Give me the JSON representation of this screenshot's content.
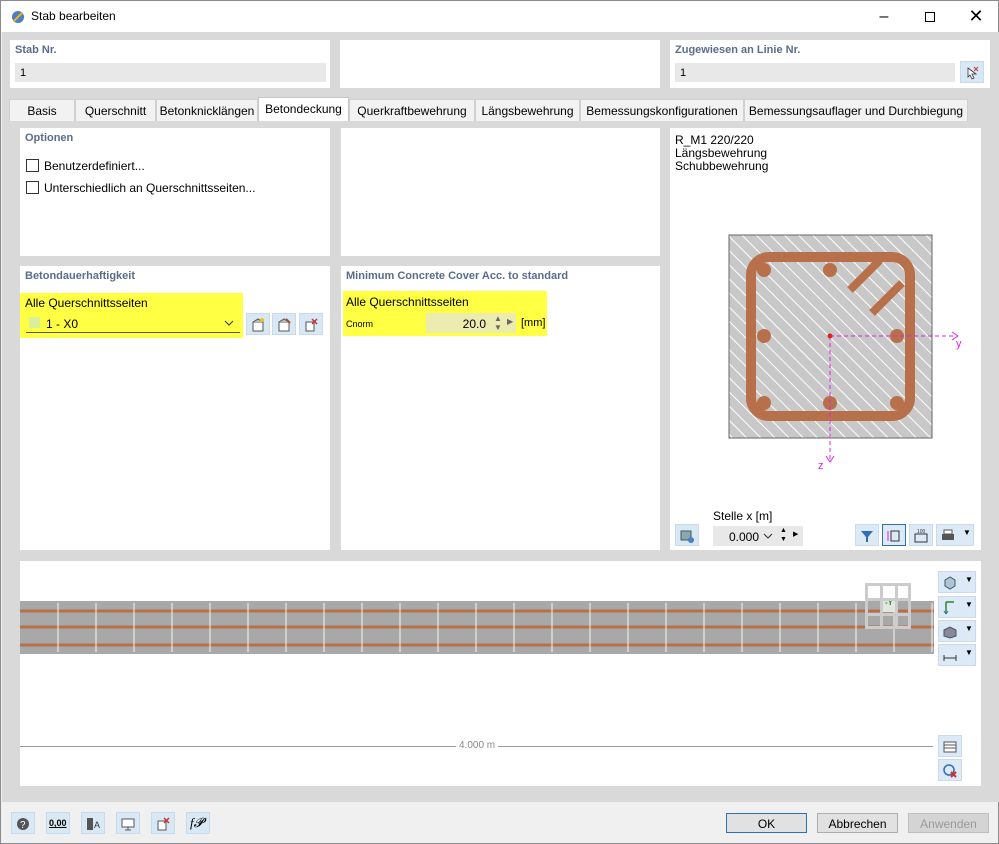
{
  "window": {
    "title": "Stab bearbeiten",
    "icons": [
      "minimize-icon",
      "maximize-icon",
      "close-icon"
    ]
  },
  "header": {
    "stab_label": "Stab Nr.",
    "stab_value": "1",
    "linie_label": "Zugewiesen an Linie Nr.",
    "linie_value": "1"
  },
  "tabs": [
    "Basis",
    "Querschnitt",
    "Betonknicklängen",
    "Betondeckung",
    "Querkraftbewehrung",
    "Längsbewehrung",
    "Bemessungskonfigurationen",
    "Bemessungsauflager und Durchbiegung"
  ],
  "active_tab": "Betondeckung",
  "optionen": {
    "title": "Optionen",
    "checkbox1": "Benutzerdefiniert...",
    "checkbox2": "Unterschiedlich an Querschnittsseiten..."
  },
  "dauer": {
    "title": "Betondauerhaftigkeit",
    "label": "Alle Querschnittsseiten",
    "value": "1 - X0"
  },
  "mincover": {
    "title": "Minimum Concrete Cover Acc. to standard",
    "label": "Alle Querschnittsseiten",
    "cnorm_label": "Cnorm",
    "cnorm_value": "20.0",
    "unit": "[mm]"
  },
  "preview": {
    "line1": "R_M1 220/220",
    "line2": "Längsbewehrung",
    "line3": "Schubbewehrung",
    "axis_y": "y",
    "axis_z": "z",
    "stelle_label": "Stelle x [m]",
    "stelle_value": "0.000"
  },
  "beam": {
    "length_label": "4.000 m",
    "view_label": "-Y"
  },
  "footer": {
    "ok": "OK",
    "cancel": "Abbrechen",
    "apply": "Anwenden",
    "icon_value": "0,00"
  },
  "colors": {
    "highlight": "#ffff44",
    "rebar": "#b8704b",
    "axis": "#e020e0",
    "title_text": "#5b6c8a"
  }
}
